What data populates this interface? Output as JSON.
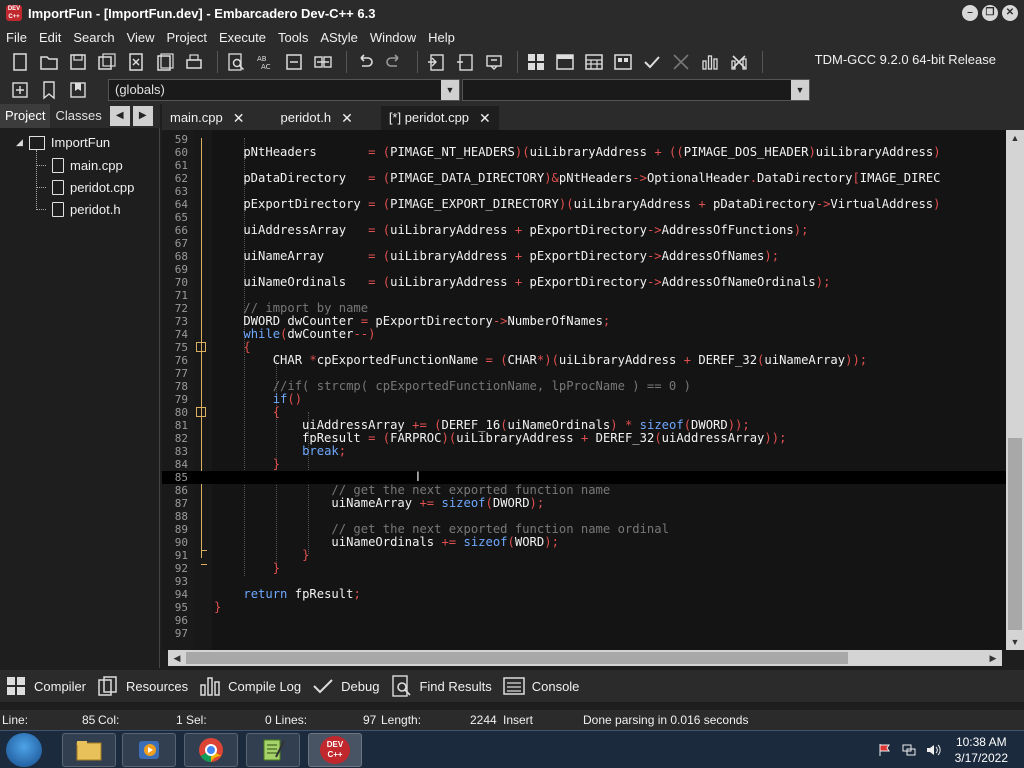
{
  "window": {
    "title": "ImportFun - [ImportFun.dev] - Embarcadero Dev-C++ 6.3",
    "app_icon_text": "DEV C++"
  },
  "menu": [
    "File",
    "Edit",
    "Search",
    "View",
    "Project",
    "Execute",
    "Tools",
    "AStyle",
    "Window",
    "Help"
  ],
  "toolbar": {
    "compiler": "TDM-GCC 9.2.0 64-bit Release",
    "scope_select": "(globals)"
  },
  "left_panel": {
    "tabs": [
      "Project",
      "Classes"
    ],
    "tree": {
      "project": "ImportFun",
      "files": [
        "main.cpp",
        "peridot.cpp",
        "peridot.h"
      ]
    }
  },
  "editor_tabs": [
    {
      "label": "main.cpp",
      "active": false
    },
    {
      "label": "peridot.h",
      "active": false
    },
    {
      "label": "[*] peridot.cpp",
      "active": true
    }
  ],
  "code_lines": [
    {
      "n": "59",
      "html": ""
    },
    {
      "n": "60",
      "html": "    pNtHeaders       <span class='op'>=</span> <span class='op'>(</span>PIMAGE_NT_HEADERS<span class='op'>)(</span>uiLibraryAddress <span class='op'>+</span> <span class='op'>((</span>PIMAGE_DOS_HEADER<span class='op'>)</span>uiLibraryAddress<span class='op'>)</span>"
    },
    {
      "n": "61",
      "html": ""
    },
    {
      "n": "62",
      "html": "    pDataDirectory   <span class='op'>=</span> <span class='op'>(</span>PIMAGE_DATA_DIRECTORY<span class='op'>)&amp;</span>pNtHeaders<span class='op'>-&gt;</span>OptionalHeader<span class='op'>.</span>DataDirectory<span class='op'>[</span>IMAGE_DIREC"
    },
    {
      "n": "63",
      "html": ""
    },
    {
      "n": "64",
      "html": "    pExportDirectory <span class='op'>=</span> <span class='op'>(</span>PIMAGE_EXPORT_DIRECTORY<span class='op'>)(</span>uiLibraryAddress <span class='op'>+</span> pDataDirectory<span class='op'>-&gt;</span>VirtualAddress<span class='op'>)</span>"
    },
    {
      "n": "65",
      "html": ""
    },
    {
      "n": "66",
      "html": "    uiAddressArray   <span class='op'>=</span> <span class='op'>(</span>uiLibraryAddress <span class='op'>+</span> pExportDirectory<span class='op'>-&gt;</span>AddressOfFunctions<span class='op'>);</span>"
    },
    {
      "n": "67",
      "html": ""
    },
    {
      "n": "68",
      "html": "    uiNameArray      <span class='op'>=</span> <span class='op'>(</span>uiLibraryAddress <span class='op'>+</span> pExportDirectory<span class='op'>-&gt;</span>AddressOfNames<span class='op'>);</span>"
    },
    {
      "n": "69",
      "html": ""
    },
    {
      "n": "70",
      "html": "    uiNameOrdinals   <span class='op'>=</span> <span class='op'>(</span>uiLibraryAddress <span class='op'>+</span> pExportDirectory<span class='op'>-&gt;</span>AddressOfNameOrdinals<span class='op'>);</span>"
    },
    {
      "n": "71",
      "html": ""
    },
    {
      "n": "72",
      "html": "    <span class='cm'>// import by name</span>"
    },
    {
      "n": "73",
      "html": "    DWORD dwCounter <span class='op'>=</span> pExportDirectory<span class='op'>-&gt;</span>NumberOfNames<span class='op'>;</span>"
    },
    {
      "n": "74",
      "html": "    <span class='kw'>while</span><span class='op'>(</span>dwCounter<span class='op'>--)</span>"
    },
    {
      "n": "75",
      "html": "    <span class='op'>{</span>"
    },
    {
      "n": "76",
      "html": "        CHAR <span class='op'>*</span>cpExportedFunctionName <span class='op'>=</span> <span class='op'>(</span>CHAR<span class='op'>*)(</span>uiLibraryAddress <span class='op'>+</span> DEREF_32<span class='op'>(</span>uiNameArray<span class='op'>));</span>"
    },
    {
      "n": "77",
      "html": ""
    },
    {
      "n": "78",
      "html": "        <span class='cm'>//if( strcmp( cpExportedFunctionName, lpProcName ) == 0 )</span>"
    },
    {
      "n": "79",
      "html": "        <span class='kw'>if</span><span class='op'>()</span>"
    },
    {
      "n": "80",
      "html": "        <span class='op'>{</span>"
    },
    {
      "n": "81",
      "html": "            uiAddressArray <span class='op'>+=</span> <span class='op'>(</span>DEREF_16<span class='op'>(</span>uiNameOrdinals<span class='op'>)</span> <span class='op'>*</span> <span class='kw'>sizeof</span><span class='op'>(</span>DWORD<span class='op'>));</span>"
    },
    {
      "n": "82",
      "html": "            fpResult <span class='op'>=</span> <span class='op'>(</span>FARPROC<span class='op'>)(</span>uiLibraryAddress <span class='op'>+</span> DEREF_32<span class='op'>(</span>uiAddressArray<span class='op'>));</span>"
    },
    {
      "n": "83",
      "html": "            <span class='kw'>break</span><span class='op'>;</span>"
    },
    {
      "n": "84",
      "html": "        <span class='op'>}</span>"
    },
    {
      "n": "85",
      "html": ""
    },
    {
      "n": "86",
      "html": "                <span class='cm'>// get the next exported function name</span>"
    },
    {
      "n": "87",
      "html": "                uiNameArray <span class='op'>+=</span> <span class='kw'>sizeof</span><span class='op'>(</span>DWORD<span class='op'>);</span>"
    },
    {
      "n": "88",
      "html": ""
    },
    {
      "n": "89",
      "html": "                <span class='cm'>// get the next exported function name ordinal</span>"
    },
    {
      "n": "90",
      "html": "                uiNameOrdinals <span class='op'>+=</span> <span class='kw'>sizeof</span><span class='op'>(</span>WORD<span class='op'>);</span>"
    },
    {
      "n": "91",
      "html": "            <span class='op'>}</span>"
    },
    {
      "n": "92",
      "html": "        <span class='op'>}</span>"
    },
    {
      "n": "93",
      "html": ""
    },
    {
      "n": "94",
      "html": "    <span class='kw'>return</span> fpResult<span class='op'>;</span>"
    },
    {
      "n": "95",
      "html": "<span class='op'>}</span>"
    },
    {
      "n": "96",
      "html": ""
    },
    {
      "n": "97",
      "html": ""
    }
  ],
  "bottom_tabs": [
    "Compiler",
    "Resources",
    "Compile Log",
    "Debug",
    "Find Results",
    "Console"
  ],
  "status": {
    "line_label": "Line:",
    "line_value": "85",
    "col_label": "Col:",
    "col_value": "1",
    "sel_label": "Sel:",
    "sel_value": "0",
    "lines_label": "Lines:",
    "lines_value": "97",
    "length_label": "Length:",
    "length_value": "2244",
    "mode": "Insert",
    "message": "Done parsing in 0.016 seconds"
  },
  "taskbar": {
    "time": "10:38 AM",
    "date": "3/17/2022"
  },
  "colors": {
    "keyword": "#6ea8ff",
    "operator": "#e05050",
    "comment": "#777777",
    "fold_marker": "#d8b060"
  }
}
